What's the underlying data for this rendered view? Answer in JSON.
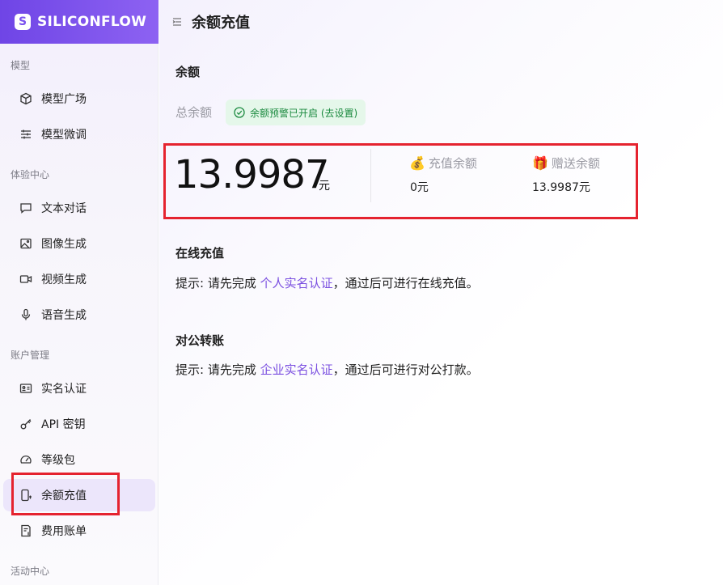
{
  "brand": {
    "name": "SILICONFLOW"
  },
  "sidebar": {
    "sections": [
      {
        "label": "模型"
      },
      {
        "label": "体验中心"
      },
      {
        "label": "账户管理"
      },
      {
        "label": "活动中心"
      }
    ],
    "items": [
      {
        "label": "模型广场",
        "icon": "cube-icon"
      },
      {
        "label": "模型微调",
        "icon": "sliders-icon"
      },
      {
        "label": "文本对话",
        "icon": "chat-bubble-icon"
      },
      {
        "label": "图像生成",
        "icon": "image-icon"
      },
      {
        "label": "视频生成",
        "icon": "video-camera-icon"
      },
      {
        "label": "语音生成",
        "icon": "microphone-icon"
      },
      {
        "label": "实名认证",
        "icon": "id-card-icon"
      },
      {
        "label": "API 密钥",
        "icon": "key-icon"
      },
      {
        "label": "等级包",
        "icon": "gauge-icon"
      },
      {
        "label": "余额充值",
        "icon": "phone-dollar-icon",
        "active": true
      },
      {
        "label": "费用账单",
        "icon": "bill-icon"
      }
    ]
  },
  "header": {
    "title": "余额充值"
  },
  "balance": {
    "heading": "余额",
    "total_label": "总余额",
    "alert_badge": "余额预警已开启 (去设置)",
    "total_amount": "13.9987",
    "unit": "元",
    "recharge_label": "充值余额",
    "recharge_value": "0元",
    "gift_label": "赠送余额",
    "gift_value": "13.9987元"
  },
  "online": {
    "heading": "在线充值",
    "tip_prefix": "提示: 请先完成 ",
    "tip_link": "个人实名认证",
    "tip_suffix": "，通过后可进行在线充值。"
  },
  "corporate": {
    "heading": "对公转账",
    "tip_prefix": "提示: 请先完成 ",
    "tip_link": "企业实名认证",
    "tip_suffix": "，通过后可进行对公打款。"
  },
  "colors": {
    "brand": "#7b52ee",
    "link": "#7a4fe0",
    "highlight": "#e5232f",
    "success": "#1b8a3f"
  }
}
